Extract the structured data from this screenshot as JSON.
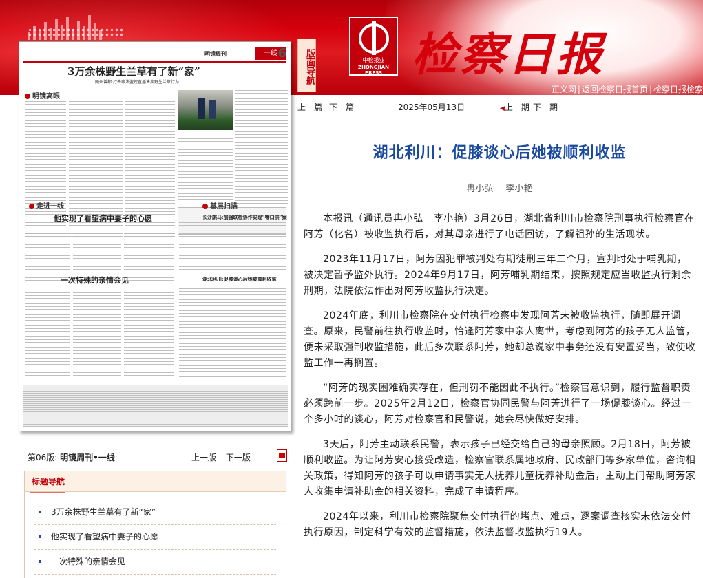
{
  "header": {
    "section_nav_label": "版面导航",
    "logo_text": "中检报业",
    "logo_subtext": "ZHONGJIAN PRESS",
    "masthead": "检察日报",
    "top_links": [
      "正义网",
      "返回检察日报首页",
      "检察日报检索"
    ]
  },
  "issue_nav": {
    "prev_article": "上一篇",
    "next_article": "下一篇",
    "date": "2025年05月13日",
    "prev_issue": "上一期",
    "next_issue": "下一期"
  },
  "paper_thumbnail": {
    "column": "明镜周刊",
    "column_tag": "一线",
    "page_number": "6",
    "headline": "3万余株野生兰草有了新“家”",
    "subline": "随州曾都:打击非法盗挖直播售卖野生兰草行为",
    "sections": [
      "明镜高眼",
      "走进一线",
      "基层扫描"
    ],
    "headlines": [
      "他实现了看望病中妻子的心愿",
      "一次特殊的亲情会见",
      "湖北利川:促膝谈心后她被顺利收监",
      "长沙跳马:加强联检协作实现“零口供”案"
    ]
  },
  "page_info": {
    "page_label": "第06版:",
    "page_name": "明镜周刊•一线",
    "prev_page": "上一版",
    "next_page": "下一版"
  },
  "title_nav": {
    "heading": "标题导航",
    "items": [
      "3万余株野生兰草有了新“家”",
      "他实现了看望病中妻子的心愿",
      "一次特殊的亲情会见"
    ]
  },
  "article": {
    "title": "湖北利川：促膝谈心后她被顺利收监",
    "authors": "冉小弘 李小艳",
    "paragraphs": [
      "本报讯（通讯员冉小弘　李小艳）3月26日，湖北省利川市检察院刑事执行检察官在阿芳（化名）被收监执行后，对其母亲进行了电话回访，了解祖孙的生活现状。",
      "2023年11月17日，阿芳因犯罪被判处有期徒刑三年二个月，宣判时处于哺乳期，被决定暂予监外执行。2024年9月17日，阿芳哺乳期结束，按照规定应当收监执行剩余刑期，法院依法作出对阿芳收监执行决定。",
      "2024年底，利川市检察院在交付执行检察中发现阿芳未被收监执行，随即展开调查。原来，民警前往执行收监时，恰逢阿芳家中亲人离世，考虑到阿芳的孩子无人监管，便未采取强制收监措施，此后多次联系阿芳，她却总说家中事务还没有安置妥当，致使收监工作一再搁置。",
      "“阿芳的现实困难确实存在，但刑罚不能因此不执行。”检察官意识到，履行监督职责必须跨前一步。2025年2月12日，检察官协同民警与阿芳进行了一场促膝谈心。经过一个多小时的谈心，阿芳对检察官和民警说，她会尽快做好安排。",
      "3天后，阿芳主动联系民警，表示孩子已经交给自己的母亲照顾。2月18日，阿芳被顺利收监。为让阿芳安心接受改造，检察官联系属地政府、民政部门等多家单位，咨询相关政策，得知阿芳的孩子可以申请事实无人抚养儿童抚养补助金后，主动上门帮助阿芳家人收集申请补助金的相关资料，完成了申请程序。",
      "2024年以来，利川市检察院聚焦交付执行的堵点、难点，逐案调查核实未依法交付执行原因，制定科学有效的监督措施，依法监督收监执行19人。"
    ]
  }
}
